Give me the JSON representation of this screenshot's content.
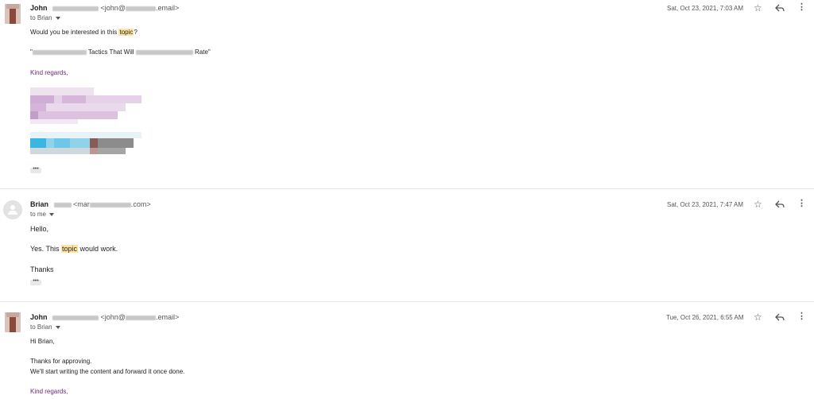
{
  "messages": [
    {
      "sender_name": "John",
      "addr_prefix": "<john@",
      "addr_suffix": ".email>",
      "to_label": "to Brian",
      "date": "Sat, Oct 23, 2021, 7:03 AM",
      "body_before": "Would you be interested in this ",
      "body_highlight": "topic",
      "body_after": "?",
      "quote_open": "\"",
      "quote_mid": " Tactics That Will ",
      "quote_end": " Rate\"",
      "sign_off": "Kind regards,"
    },
    {
      "sender_name": "Brian",
      "addr_prefix": "<mar",
      "addr_suffix": ".com>",
      "to_label": "to me",
      "date": "Sat, Oct 23, 2021, 7:47 AM",
      "greeting": "Hello,",
      "body_before": "Yes. This ",
      "body_highlight": "topic",
      "body_after": " would work.",
      "thanks": "Thanks"
    },
    {
      "sender_name": "John",
      "addr_prefix": "<john@",
      "addr_suffix": ".email>",
      "to_label": "to Brian",
      "date": "Tue, Oct 26, 2021, 6:55 AM",
      "greeting": "Hi Brian,",
      "line1": "Thanks for approving.",
      "line2": "We'll start writing the content and forward it once done.",
      "sign_off": "Kind regards,"
    }
  ],
  "icons": {
    "star": "☆",
    "more": "⋮",
    "ellipsis": "•••"
  },
  "colors": {
    "highlight": "#fde6a3",
    "signature": "#6b2a7a"
  }
}
